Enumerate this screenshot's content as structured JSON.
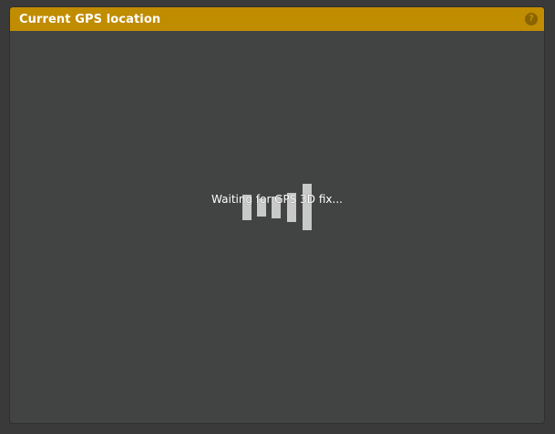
{
  "panel": {
    "title": "Current GPS location",
    "help_symbol": "?",
    "help_icon": "help-question-icon",
    "header_color": "#c08c00",
    "background_color": "#424343"
  },
  "loading": {
    "status_text": "Waiting for GPS 3D fix...",
    "icon": "loading-bars-icon"
  }
}
